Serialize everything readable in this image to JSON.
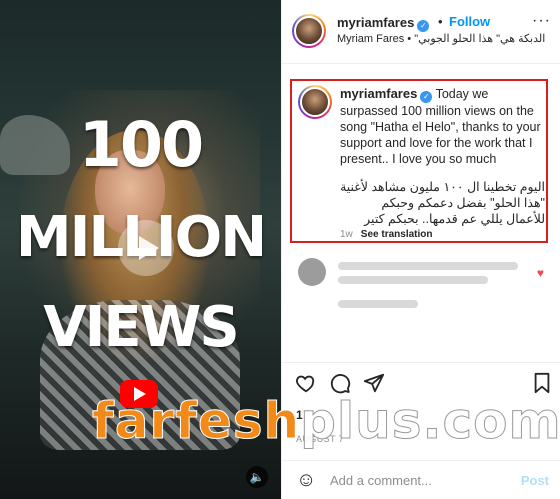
{
  "video": {
    "overlay_line1": "100",
    "overlay_line2": "MILLION",
    "overlay_line3": "VIEWS",
    "mute_icon": "🔈"
  },
  "watermark": {
    "part1": "farfesh",
    "part2": "plus.com"
  },
  "header": {
    "username": "myriamfares",
    "dot": "•",
    "follow": "Follow",
    "subtitle": "Myriam Fares • \"الدبكة هي\" هذا الحلو الجوبي",
    "more": "···"
  },
  "caption": {
    "username": "myriamfares",
    "text_en": " Today we surpassed 100 million views on the song \"Hatha el Helo\", thanks to your support and love for the work that I present.. I love you so much",
    "text_ar": "اليوم تخطينا ال ١٠٠ مليون مشاهد لأغنية \"هذا الحلو\" بفضل دعمكم وحبكم للأعمال يللي عم قدمها.. بحبكم كتير",
    "time": "1w",
    "see_translation": "See translation"
  },
  "actions": {
    "like_icon": "heart-icon",
    "comment_icon": "comment-icon",
    "share_icon": "share-icon",
    "save_icon": "bookmark-icon"
  },
  "likes_partial": "1",
  "date": "AUGUST 7",
  "add_comment": {
    "placeholder": "Add a comment...",
    "post": "Post",
    "emoji_icon": "emoji-icon"
  },
  "colors": {
    "follow": "#0095f6",
    "highlight_border": "#d71f1f",
    "watermark_orange": "#f28a1a",
    "youtube_red": "#ff0000"
  }
}
